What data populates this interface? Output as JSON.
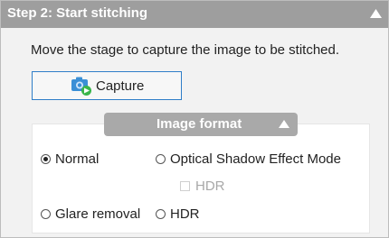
{
  "header": {
    "title": "Step 2: Start stitching",
    "icon": "chevron-up-icon"
  },
  "instruction": "Move the stage to capture the image to be stitched.",
  "capture": {
    "label": "Capture",
    "icon": "camera-icon"
  },
  "image_format": {
    "title": "Image format",
    "icon": "chevron-up-icon",
    "options": [
      {
        "label": "Normal",
        "selected": true
      },
      {
        "label": "Optical Shadow Effect Mode",
        "selected": false
      },
      {
        "label": "Glare removal",
        "selected": false
      },
      {
        "label": "HDR",
        "selected": false
      }
    ],
    "sub_option": {
      "label": "HDR",
      "checked": false,
      "enabled": false
    }
  },
  "colors": {
    "header_bg": "#9e9e9e",
    "panel_bg": "#f2f2f2",
    "button_border": "#2f7ec8",
    "tab_bg": "#a9a9a9",
    "camera_blue": "#3a8fd6",
    "camera_green": "#39b54a"
  }
}
